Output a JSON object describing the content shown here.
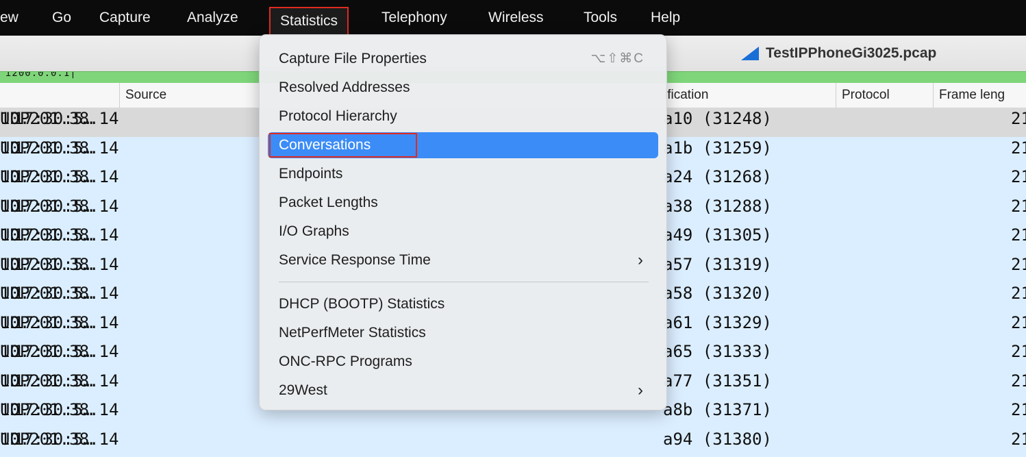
{
  "menubar": {
    "items": [
      "ew",
      "Go",
      "Capture",
      "Analyze",
      "Statistics",
      "Telephony",
      "Wireless",
      "Tools",
      "Help"
    ],
    "active": "Statistics"
  },
  "window": {
    "title": "TestIPPhoneGi3025.pcap"
  },
  "filter": {
    "text": "ɪ200.0.0.1|"
  },
  "columns": [
    "Source",
    "ification",
    "Protocol",
    "Frame leng"
  ],
  "rows": [
    {
      "time": "17:30:5…",
      "source": "10.201.38.14",
      "ident": "a10 (31248)",
      "protocol": "UDP",
      "len": "21"
    },
    {
      "time": "17:30:5…",
      "source": "10.201.38.14",
      "ident": "a1b (31259)",
      "protocol": "UDP",
      "len": "21"
    },
    {
      "time": "17:30:5…",
      "source": "10.201.38.14",
      "ident": "a24 (31268)",
      "protocol": "UDP",
      "len": "21"
    },
    {
      "time": "17:30:5…",
      "source": "10.201.38.14",
      "ident": "a38 (31288)",
      "protocol": "UDP",
      "len": "21"
    },
    {
      "time": "17:30:5…",
      "source": "10.201.38.14",
      "ident": "a49 (31305)",
      "protocol": "UDP",
      "len": "21"
    },
    {
      "time": "17:30:5…",
      "source": "10.201.38.14",
      "ident": "a57 (31319)",
      "protocol": "UDP",
      "len": "21"
    },
    {
      "time": "17:30:5…",
      "source": "10.201.38.14",
      "ident": "a58 (31320)",
      "protocol": "UDP",
      "len": "21"
    },
    {
      "time": "17:30:5…",
      "source": "10.201.38.14",
      "ident": "a61 (31329)",
      "protocol": "UDP",
      "len": "21"
    },
    {
      "time": "17:30:5…",
      "source": "10.201.38.14",
      "ident": "a65 (31333)",
      "protocol": "UDP",
      "len": "21"
    },
    {
      "time": "17:30:5…",
      "source": "10.201.38.14",
      "ident": "a77 (31351)",
      "protocol": "UDP",
      "len": "21"
    },
    {
      "time": "17:30:5…",
      "source": "10.201.38.14",
      "ident": "a8b (31371)",
      "protocol": "UDP",
      "len": "21"
    },
    {
      "time": "17:30:5…",
      "source": "10.201.38.14",
      "ident": "a94 (31380)",
      "protocol": "UDP",
      "len": "21"
    }
  ],
  "statistics_menu": {
    "items": [
      {
        "label": "Capture File Properties",
        "shortcut": "⌥⇧⌘C"
      },
      {
        "label": "Resolved Addresses"
      },
      {
        "label": "Protocol Hierarchy"
      },
      {
        "label": "Conversations",
        "highlighted": true
      },
      {
        "label": "Endpoints"
      },
      {
        "label": "Packet Lengths"
      },
      {
        "label": "I/O Graphs"
      },
      {
        "label": "Service Response Time",
        "submenu": true
      },
      {
        "label": "DHCP (BOOTP) Statistics"
      },
      {
        "label": "NetPerfMeter Statistics"
      },
      {
        "label": "ONC-RPC Programs"
      },
      {
        "label": "29West",
        "submenu": true
      }
    ]
  },
  "colors": {
    "menubar_bg": "#0b0b0b",
    "highlight_blue": "#3b8cf7",
    "annotation_red": "#e02b20",
    "row_blue": "#dbeeff",
    "row_selected": "#d9d9d9",
    "filter_green": "#7fd67a",
    "title_icon": "#1a6fd6"
  },
  "icons": {
    "title": "wireshark-fin-icon",
    "submenu": "chevron-right-icon"
  }
}
